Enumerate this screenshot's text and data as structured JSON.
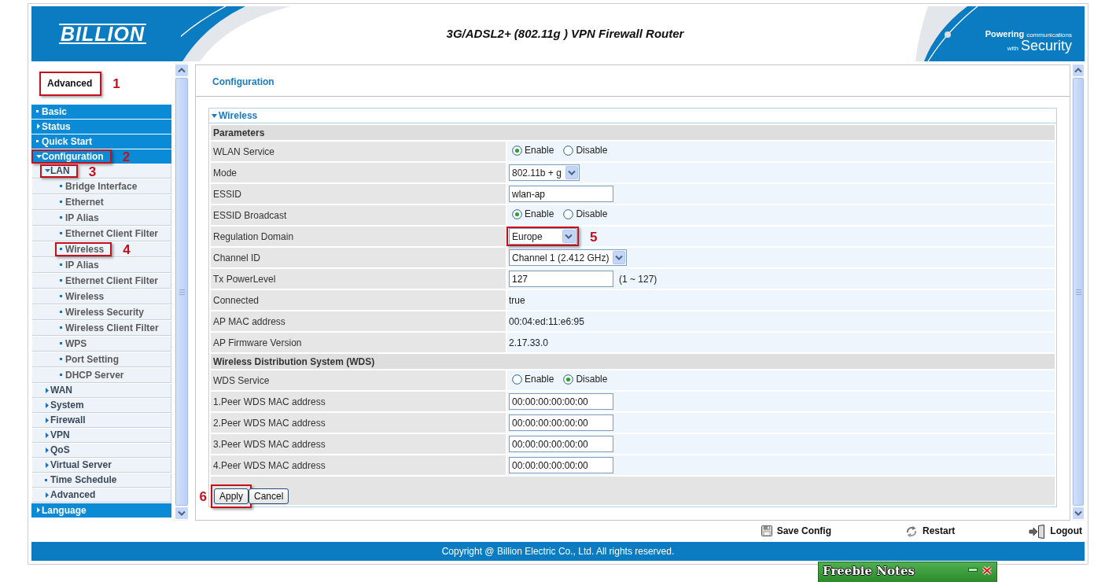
{
  "header": {
    "logo": "BILLION",
    "title": "3G/ADSL2+ (802.11g ) VPN Firewall Router",
    "tagline": [
      [
        {
          "text": "Powering",
          "kind": "strong"
        },
        {
          "text": "communications",
          "kind": "small"
        }
      ],
      [
        {
          "text": "with",
          "kind": "small"
        },
        {
          "text": "Security",
          "kind": "large"
        }
      ]
    ]
  },
  "sidebar": {
    "heading": {
      "text": "Advanced",
      "callout": "1"
    },
    "items": [
      {
        "label": "Basic",
        "kind": "page"
      },
      {
        "label": "Status",
        "kind": "folder",
        "expanded": false
      },
      {
        "label": "Quick Start",
        "kind": "page"
      },
      {
        "label": "Configuration",
        "kind": "folder",
        "expanded": true,
        "callout": "2",
        "children": [
          {
            "label": "LAN",
            "kind": "folder",
            "expanded": true,
            "callout": "3",
            "children": [
              {
                "label": "Bridge Interface",
                "kind": "page"
              },
              {
                "label": "Ethernet",
                "kind": "page"
              },
              {
                "label": "IP Alias",
                "kind": "page"
              },
              {
                "label": "Ethernet Client Filter",
                "kind": "page"
              },
              {
                "label": "Wireless",
                "kind": "page",
                "callout": "4"
              },
              {
                "label": "IP Alias",
                "kind": "page"
              },
              {
                "label": "Ethernet Client Filter",
                "kind": "page"
              },
              {
                "label": "Wireless",
                "kind": "page"
              },
              {
                "label": "Wireless Security",
                "kind": "page"
              },
              {
                "label": "Wireless Client Filter",
                "kind": "page"
              },
              {
                "label": "WPS",
                "kind": "page"
              },
              {
                "label": "Port Setting",
                "kind": "page"
              },
              {
                "label": "DHCP Server",
                "kind": "page"
              }
            ]
          },
          {
            "label": "WAN",
            "kind": "folder",
            "expanded": false
          },
          {
            "label": "System",
            "kind": "folder",
            "expanded": false
          },
          {
            "label": "Firewall",
            "kind": "folder",
            "expanded": false
          },
          {
            "label": "VPN",
            "kind": "folder",
            "expanded": false
          },
          {
            "label": "QoS",
            "kind": "folder",
            "expanded": false
          },
          {
            "label": "Virtual Server",
            "kind": "folder",
            "expanded": false
          },
          {
            "label": "Time Schedule",
            "kind": "page"
          },
          {
            "label": "Advanced",
            "kind": "folder",
            "expanded": false
          }
        ]
      },
      {
        "label": "Language",
        "kind": "folder",
        "expanded": false
      }
    ]
  },
  "main": {
    "title": "Configuration",
    "section": {
      "title": "Wireless",
      "expanded": true,
      "groups": [
        {
          "title": "Parameters",
          "rows": [
            {
              "label": "WLAN Service",
              "kind": "radio",
              "options": [
                {
                  "label": "Enable",
                  "selected": true
                },
                {
                  "label": "Disable",
                  "selected": false
                }
              ]
            },
            {
              "label": "Mode",
              "kind": "select",
              "value": "802.11b + g"
            },
            {
              "label": "ESSID",
              "kind": "input",
              "value": "wlan-ap"
            },
            {
              "label": "ESSID Broadcast",
              "kind": "radio",
              "options": [
                {
                  "label": "Enable",
                  "selected": true
                },
                {
                  "label": "Disable",
                  "selected": false
                }
              ]
            },
            {
              "label": "Regulation Domain",
              "kind": "select",
              "value": "Europe",
              "callout": "5"
            },
            {
              "label": "Channel ID",
              "kind": "select",
              "value": "Channel 1 (2.412 GHz)"
            },
            {
              "label": "Tx PowerLevel",
              "kind": "input",
              "value": "127",
              "hint": "(1 ~ 127)"
            },
            {
              "label": "Connected",
              "kind": "text",
              "value": "true"
            },
            {
              "label": "AP MAC address",
              "kind": "text",
              "value": "00:04:ed:11:e6:95"
            },
            {
              "label": "AP Firmware Version",
              "kind": "text",
              "value": "2.17.33.0"
            }
          ]
        },
        {
          "title": "Wireless Distribution System (WDS)",
          "rows": [
            {
              "label": "WDS Service",
              "kind": "radio",
              "options": [
                {
                  "label": "Enable",
                  "selected": false
                },
                {
                  "label": "Disable",
                  "selected": true
                }
              ]
            },
            {
              "label": "1.Peer WDS MAC address",
              "kind": "input",
              "value": "00:00:00:00:00:00"
            },
            {
              "label": "2.Peer WDS MAC address",
              "kind": "input",
              "value": "00:00:00:00:00:00"
            },
            {
              "label": "3.Peer WDS MAC address",
              "kind": "input",
              "value": "00:00:00:00:00:00"
            },
            {
              "label": "4.Peer WDS MAC address",
              "kind": "input",
              "value": "00:00:00:00:00:00"
            }
          ]
        }
      ],
      "buttons": [
        {
          "label": "Apply",
          "callout": "6"
        },
        {
          "label": "Cancel"
        }
      ]
    }
  },
  "actions": [
    {
      "label": "Save Config",
      "kind": "save"
    },
    {
      "label": "Restart",
      "kind": "restart"
    },
    {
      "label": "Logout",
      "kind": "logout"
    }
  ],
  "footer": {
    "text": "Copyright @ Billion Electric Co., Ltd. All rights reserved."
  },
  "notes_widget": {
    "title": "Freebie Notes"
  }
}
